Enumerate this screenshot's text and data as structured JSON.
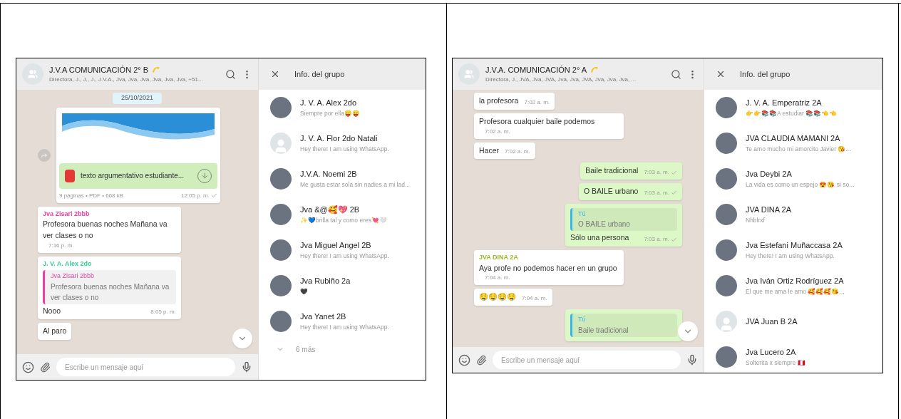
{
  "panels": [
    {
      "chat": {
        "title": "J.V.A COMUNICACIÓN 2° B",
        "subtitle": "Directora, J., J., J., J.V.A., Jva, Jva, Jva, Jva, Jva, Jva, +51...",
        "input_placeholder": "Escribe un mensaje aquí",
        "messages": [
          {
            "kind": "date",
            "text": "25/10/2021"
          },
          {
            "kind": "document",
            "file": "texto argumentativo estudiante...",
            "meta": "9 páginas • PDF • 668 kB",
            "time": "12:05 p. m.",
            "sent": true
          },
          {
            "kind": "incoming",
            "sender": "Jva Zisari 2bbb",
            "color": "#e542a3",
            "text": "Profesora buenas noches Mañana va ver clases o no",
            "time": "7:16 p. m.",
            "sent": false
          },
          {
            "kind": "incoming",
            "sender": "J. V. A. Alex 2do",
            "color": "#35cd96",
            "quote": {
              "sender": "Jva Zisari 2bbb",
              "color": "#e542a3",
              "text": "Profesora buenas noches Mañana va ver clases o no"
            },
            "text": "Nooo",
            "time": "8:05 p. m.",
            "sent": false
          },
          {
            "kind": "incoming",
            "text": "Al paro"
          }
        ]
      },
      "info": {
        "title": "Info. del grupo",
        "members": [
          {
            "name": "J. V. A. Alex 2do",
            "status": "Siempre por ella😛😛",
            "kind": "photo"
          },
          {
            "name": "J. V. A. Flor 2do Natali",
            "status": "Hey there! I am using WhatsApp.",
            "kind": "default"
          },
          {
            "name": "J.V.A. Noemi 2B",
            "status": "Me gusta estar sola sin nadies a mi lad...",
            "kind": "photo"
          },
          {
            "name": "Jva &@🥰💖 2B",
            "status": "✨💙brilla tal y como eres💘🤍",
            "kind": "photo"
          },
          {
            "name": "Jva Miguel Angel 2B",
            "status": "Hey there! I am using WhatsApp.",
            "kind": "photo"
          },
          {
            "name": "Jva Rubiño 2a",
            "status": "🖤",
            "kind": "photo"
          },
          {
            "name": "Jva Yanet 2B",
            "status": "Hey there! I am using WhatsApp.",
            "kind": "photo"
          }
        ],
        "more": "6 más"
      }
    },
    {
      "chat": {
        "title": "J.V.A. COMUNICACIÓN 2° A",
        "subtitle": "Directora, J., JVA, Jva, JVA, Jva, Jva, JVA, Jva, Jva, Jva, ...",
        "input_placeholder": "Escribe un mensaje aquí",
        "messages": [
          {
            "kind": "incoming",
            "text": "la profesora",
            "time": "7:02 a. m.",
            "sent": false
          },
          {
            "kind": "incoming",
            "text": "Profesora cualquier baile  podemos",
            "time": "7:02 a. m.",
            "sent": false
          },
          {
            "kind": "incoming",
            "text": "Hacer",
            "time": "7:02 a. m.",
            "sent": false
          },
          {
            "kind": "outgoing",
            "text": "Baile tradicional",
            "time": "7:03 a. m.",
            "sent": true
          },
          {
            "kind": "outgoing",
            "text": "O BAILE urbano",
            "time": "7:03 a. m.",
            "sent": true
          },
          {
            "kind": "outgoing",
            "quote": {
              "sender": "Tú",
              "color": "#35b6e6",
              "text": "O BAILE urbano"
            },
            "text": "Sólo una persona",
            "time": "7:03 a. m.",
            "sent": true
          },
          {
            "kind": "incoming",
            "sender": "JVA DINA 2A",
            "color": "#9cb82e",
            "text": "Aya profe no podemos hacer en un grupo",
            "time": "7:04 a. m.",
            "sent": false
          },
          {
            "kind": "incoming",
            "text": "🤤🤤🤤🤤",
            "time": "7:04 a. m.",
            "sent": false
          },
          {
            "kind": "outgoing",
            "quote": {
              "sender": "Tú",
              "color": "#35b6e6",
              "text": "Baile tradicional"
            }
          }
        ]
      },
      "info": {
        "title": "Info. del grupo",
        "members": [
          {
            "name": "J. V. A. Emperatriz 2A",
            "status": "👉👉📚📚A estudiar 📚📚👈👈",
            "kind": "photo"
          },
          {
            "name": "JVA CLAUDIA MAMANI 2A",
            "status": "Te amo mucho mi amorcito Javier 😘...",
            "kind": "photo"
          },
          {
            "name": "Jva Deybi 2A",
            "status": "La vida es como un espejo 😍😘 si so...",
            "kind": "photo"
          },
          {
            "name": "JVA DINA 2A",
            "status": "Nhblrxf",
            "kind": "photo"
          },
          {
            "name": "Jva Estefani Muñaccasa 2A",
            "status": "Hey there! I am using WhatsApp.",
            "kind": "photo"
          },
          {
            "name": "Jva Iván Ortiz Rodríguez 2A",
            "status": "El que me ama le amo 🥰🥰🥰😘...",
            "kind": "photo"
          },
          {
            "name": "JVA Juan B 2A",
            "kind": "default"
          },
          {
            "name": "Jva Lucero 2A",
            "status": "Solterita x siempre 🇵🇪",
            "kind": "photo"
          }
        ]
      }
    }
  ]
}
